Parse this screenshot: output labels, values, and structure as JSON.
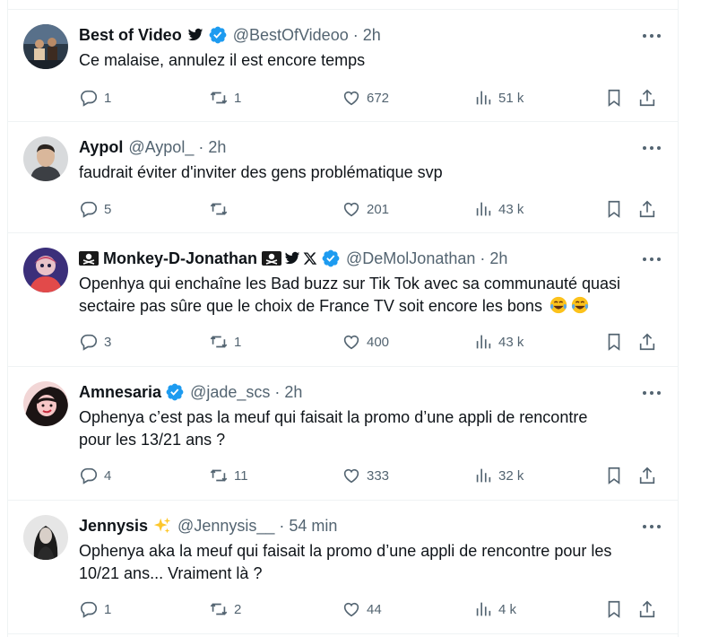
{
  "tweets": [
    {
      "name": "Best of Video",
      "handle": "@BestOfVideoo",
      "sep": "·",
      "time": "2h",
      "text": "Ce malaise, annulez il est encore temps",
      "replies": "1",
      "retweets": "1",
      "likes": "672",
      "views": "51 k",
      "avatar": "avatar-video-thumbnail",
      "name_icons": [
        "twitter-bird-icon"
      ],
      "verified": true
    },
    {
      "name": "Aypol",
      "handle": "@Aypol_",
      "sep": "·",
      "time": "2h",
      "text": "faudrait éviter d'inviter des gens problématique svp",
      "replies": "5",
      "retweets": "",
      "likes": "201",
      "views": "43 k",
      "avatar": "avatar-young-man-hoodie",
      "name_icons": [],
      "verified": false
    },
    {
      "name": "Monkey-D-Jonathan",
      "handle": "@DeMolJonathan",
      "sep": "·",
      "time": "2h",
      "text_line1": "Openhya qui enchaîne les Bad buzz sur Tik Tok avec sa communauté quasi",
      "text_line2": "sectaire pas sûre que le choix de France TV soit encore les bons",
      "replies": "3",
      "retweets": "1",
      "likes": "400",
      "views": "43 k",
      "avatar": "avatar-anime-character",
      "name_icons": [
        "pirate-flag-icon",
        "pirate-flag-icon",
        "twitter-bird-icon",
        "x-logo-icon"
      ],
      "verified": true,
      "text_emojis": [
        "tears-of-joy-emoji",
        "tears-of-joy-emoji"
      ]
    },
    {
      "name": "Amnesaria",
      "handle": "@jade_scs",
      "sep": "·",
      "time": "2h",
      "text_line1": "Ophenya c’est pas la meuf qui faisait la promo d’une appli de rencontre",
      "text_line2": "pour les 13/21 ans ?",
      "replies": "4",
      "retweets": "11",
      "likes": "333",
      "views": "32 k",
      "avatar": "avatar-illustration-girl",
      "name_icons": [],
      "verified": true
    },
    {
      "name": "Jennysis",
      "handle": "@Jennysis__",
      "sep": "·",
      "time": "54 min",
      "text_line1": "Ophenya aka la meuf qui faisait la promo d’une appli de rencontre pour les",
      "text_line2": "10/21 ans... Vraiment là ?",
      "replies": "1",
      "retweets": "2",
      "likes": "44",
      "views": "4 k",
      "avatar": "avatar-woman-photo",
      "name_icons": [
        "sparkles-emoji"
      ],
      "verified": false
    }
  ],
  "colors": {
    "text": "#0f1419",
    "muted": "#536471",
    "verified": "#1d9bf0",
    "divider": "#eff3f4"
  }
}
